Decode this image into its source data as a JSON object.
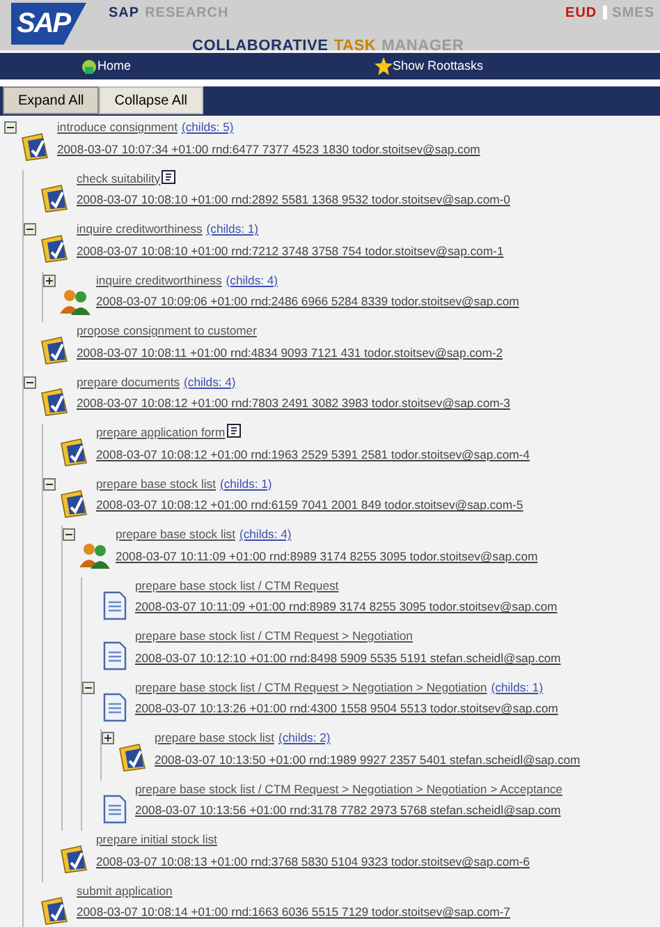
{
  "header": {
    "logo": "SAP",
    "brand": [
      {
        "text": "SAP",
        "color": "#1f3266"
      },
      {
        "text": "RESEARCH",
        "color": "#9a9a9a"
      }
    ],
    "product": [
      {
        "text": "COLLABORATIVE",
        "color": "#1f3266"
      },
      {
        "text": "TASK",
        "color": "#c98500"
      },
      {
        "text": "MANAGER",
        "color": "#9a9a9a"
      }
    ],
    "tags": [
      {
        "text": "EUD",
        "color": "#cc1111"
      },
      {
        "text": "SMES",
        "color": "#9a9a9a"
      }
    ]
  },
  "nav": [
    {
      "label": "Home",
      "kind": "home"
    },
    {
      "label": "Show Roottasks",
      "kind": "star"
    }
  ],
  "toolbar": [
    "Expand All",
    "Collapse All"
  ],
  "tree": [
    {
      "kind": "task",
      "title": "introduce consignment",
      "childs": "(childs: 5)",
      "expanded": true,
      "detail": "2008-03-07  10:07:34  +01:00  rnd:6477  7377  4523  1830  todor.stoitsev@sap.com",
      "children": [
        {
          "kind": "task",
          "title": "check suitability",
          "note": true,
          "detail": "2008-03-07  10:08:10  +01:00  rnd:2892  5581  1368  9532  todor.stoitsev@sap.com-0"
        },
        {
          "kind": "task",
          "title": "inquire creditworthiness",
          "childs": "(childs: 1)",
          "expanded": true,
          "detail": "2008-03-07  10:08:10  +01:00  rnd:7212  3748  3758  754  todor.stoitsev@sap.com-1",
          "children": [
            {
              "kind": "group",
              "title": "inquire creditworthiness",
              "childs": "(childs: 4)",
              "expanded": false,
              "detail": "2008-03-07  10:09:06  +01:00  rnd:2486  6966  5284  8339  todor.stoitsev@sap.com"
            }
          ]
        },
        {
          "kind": "task",
          "title": "propose consignment to customer",
          "detail": "2008-03-07  10:08:11  +01:00  rnd:4834  9093  7121  431  todor.stoitsev@sap.com-2"
        },
        {
          "kind": "task",
          "title": "prepare documents",
          "childs": "(childs: 4)",
          "expanded": true,
          "detail": "2008-03-07  10:08:12  +01:00  rnd:7803  2491  3082  3983  todor.stoitsev@sap.com-3",
          "children": [
            {
              "kind": "task",
              "title": "prepare application form",
              "note": true,
              "detail": "2008-03-07  10:08:12  +01:00  rnd:1963  2529  5391  2581  todor.stoitsev@sap.com-4"
            },
            {
              "kind": "task",
              "title": "prepare base stock list",
              "childs": "(childs: 1)",
              "expanded": true,
              "detail": "2008-03-07  10:08:12  +01:00  rnd:6159  7041  2001  849  todor.stoitsev@sap.com-5",
              "children": [
                {
                  "kind": "group",
                  "title": "prepare base stock list",
                  "childs": "(childs: 4)",
                  "expanded": true,
                  "detail": "2008-03-07  10:11:09  +01:00  rnd:8989  3174  8255  3095  todor.stoitsev@sap.com",
                  "children": [
                    {
                      "kind": "doc",
                      "title": "prepare base stock list / CTM Request",
                      "detail": "2008-03-07  10:11:09  +01:00  rnd:8989  3174  8255  3095  todor.stoitsev@sap.com"
                    },
                    {
                      "kind": "doc",
                      "title": "prepare base stock list / CTM Request > Negotiation",
                      "detail": "2008-03-07  10:12:10  +01:00  rnd:8498  5909  5535  5191  stefan.scheidl@sap.com"
                    },
                    {
                      "kind": "doc",
                      "title": "prepare base stock list / CTM Request > Negotiation > Negotiation",
                      "childs": "(childs: 1)",
                      "expanded": true,
                      "detail": "2008-03-07  10:13:26  +01:00  rnd:4300  1558  9504  5513  todor.stoitsev@sap.com",
                      "children": [
                        {
                          "kind": "task",
                          "title": "prepare base stock list",
                          "childs": "(childs: 2)",
                          "expanded": false,
                          "detail": "2008-03-07  10:13:50  +01:00  rnd:1989  9927  2357  5401  stefan.scheidl@sap.com"
                        }
                      ]
                    },
                    {
                      "kind": "doc",
                      "title": "prepare base stock list / CTM Request > Negotiation > Negotiation > Acceptance",
                      "detail": "2008-03-07  10:13:56  +01:00  rnd:3178  7782  2973  5768  stefan.scheidl@sap.com"
                    }
                  ]
                }
              ]
            },
            {
              "kind": "task",
              "title": "prepare initial stock list",
              "detail": "2008-03-07  10:08:13  +01:00  rnd:3768  5830  5104  9323  todor.stoitsev@sap.com-6"
            }
          ]
        },
        {
          "kind": "task",
          "title": "submit application",
          "detail": "2008-03-07  10:08:14  +01:00  rnd:1663  6036  5515  7129  todor.stoitsev@sap.com-7"
        }
      ]
    }
  ]
}
